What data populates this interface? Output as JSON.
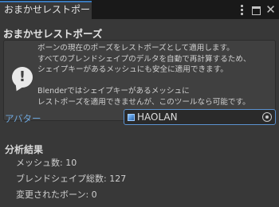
{
  "tab": {
    "title": "おまかせレストポーズ"
  },
  "panel": {
    "title": "おまかせレストポーズ",
    "help_lines": [
      "ボーンの現在のポーズをレストポーズとして適用します。",
      "すべてのブレンドシェイプのデルタを自動で再計算するため、",
      "シェイプキーがあるメッシュにも安全に適用できます。",
      "",
      "Blenderではシェイプキーがあるメッシュに",
      "レストポーズを適用できませんが、このツールなら可能です。"
    ],
    "avatar": {
      "label": "アバター",
      "value": "HAOLAN"
    },
    "analysis": {
      "title": "分析結果",
      "mesh_count": "メッシュ数: 10",
      "blendshape_total": "ブレンドシェイプ総数: 127",
      "changed_bones": "変更されたボーン: 0"
    }
  },
  "colors": {
    "accent": "#3a79bb",
    "label_link": "#6fa8de",
    "panel_bg": "#383838"
  },
  "icons": [
    "kebab-menu-icon",
    "maximize-icon",
    "close-icon",
    "info-warning-icon",
    "cube-icon",
    "target-picker-icon"
  ]
}
